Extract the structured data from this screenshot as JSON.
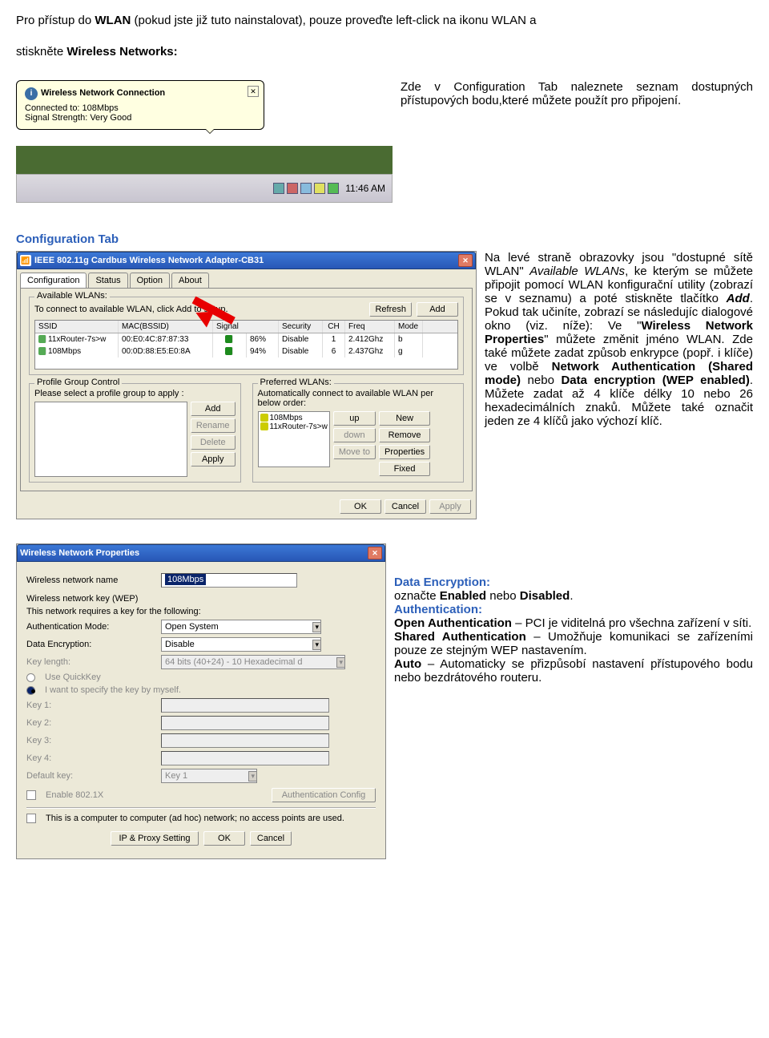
{
  "intro": {
    "p1a": "Pro přístup do ",
    "wlan": "WLAN",
    "p1b": " (pokud jste již tuto nainstalovat), pouze proveďte left-click na ikonu WLAN  a",
    "p2a": "stiskněte ",
    "wn": "Wireless Networks:",
    "p3": "Zde v Configuration Tab naleznete seznam dostupných přístupových bodu,které můžete použít pro připojení."
  },
  "balloon": {
    "title": "Wireless Network Connection",
    "l1": "Connected to: 108Mbps",
    "l2": "Signal Strength: Very Good",
    "time": "11:46 AM"
  },
  "section2": {
    "heading": "Configuration Tab",
    "para_spans": [
      {
        "t": "Na levé straně obrazovky jsou \"dostupné sítě WLAN\" ",
        "c": ""
      },
      {
        "t": "Available WLANs",
        "c": "italic"
      },
      {
        "t": ", ke kterým se můžete připojit pomocí WLAN konfigurační utility (zobrazí se v seznamu) a poté stiskněte tlačítko ",
        "c": ""
      },
      {
        "t": "Add",
        "c": "bold italic"
      },
      {
        "t": ". Pokud tak učiníte, zobrazí se následujíc dialogové okno (viz. níže): Ve \"",
        "c": ""
      },
      {
        "t": "Wireless Network Properties",
        "c": "bold"
      },
      {
        "t": "\" můžete změnit jméno WLAN. Zde také můžete zadat způsob enkrypce (popř. i klíče)  ve volbě ",
        "c": ""
      },
      {
        "t": "Network Authentication (Shared mode)",
        "c": "bold"
      },
      {
        "t": " nebo  ",
        "c": ""
      },
      {
        "t": "Data encryption (WEP enabled)",
        "c": "bold"
      },
      {
        "t": ". Můžete zadat až 4 klíče délky 10 nebo 26 hexadecimálních znaků. Můžete také označit jeden ze 4 klíčů jako výchozí klíč.",
        "c": ""
      }
    ],
    "util": {
      "title": "IEEE 802.11g Cardbus Wireless Network Adapter-CB31",
      "tabs": [
        "Configuration",
        "Status",
        "Option",
        "About"
      ],
      "avail_label": "Available WLANs:",
      "avail_hint": "To connect to available WLAN, click Add to setup.",
      "btn_refresh": "Refresh",
      "btn_add": "Add",
      "cols": [
        "SSID",
        "MAC(BSSID)",
        "Signal",
        "Security",
        "CH",
        "Freq",
        "Mode"
      ],
      "rows": [
        {
          "ssid": "11xRouter-7s>w",
          "mac": "00:E0:4C:87:87:33",
          "sig": "86%",
          "sec": "Disable",
          "ch": "1",
          "freq": "2.412Ghz",
          "mode": "b"
        },
        {
          "ssid": "108Mbps",
          "mac": "00:0D:88:E5:E0:8A",
          "sig": "94%",
          "sec": "Disable",
          "ch": "6",
          "freq": "2.437Ghz",
          "mode": "g"
        }
      ],
      "pgc": "Profile Group Control",
      "pgc_hint": "Please select a profile group to apply :",
      "pwl": "Preferred WLANs:",
      "pwl_hint": "Automatically connect to available WLAN per below order:",
      "pref": [
        "108Mbps",
        "11xRouter-7s>w"
      ],
      "btns_left": [
        "Add",
        "Rename",
        "Delete",
        "Apply"
      ],
      "btns_right": [
        "New",
        "Remove",
        "Properties",
        "Fixed"
      ],
      "btns_mid": [
        "up",
        "down",
        "Move to"
      ],
      "ok": "OK",
      "cancel": "Cancel",
      "apply": "Apply"
    }
  },
  "section3": {
    "para_spans": [
      {
        "t": "Data Encryption:",
        "c": "bold link"
      },
      {
        "t": "\n                       označte ",
        "c": ""
      },
      {
        "t": "Enabled",
        "c": "bold"
      },
      {
        "t": " nebo ",
        "c": ""
      },
      {
        "t": "Disabled",
        "c": "bold"
      },
      {
        "t": ".\n",
        "c": ""
      },
      {
        "t": "Authentication:",
        "c": "bold link"
      },
      {
        "t": "\n",
        "c": ""
      },
      {
        "t": "Open Authentication",
        "c": "bold"
      },
      {
        "t": " – PCI je viditelná pro všechna zařízení v síti.\n",
        "c": ""
      },
      {
        "t": "Shared Authentication",
        "c": "bold"
      },
      {
        "t": " – Umožňuje komunikaci se zařízeními pouze ze stejným  WEP nastavením.\n",
        "c": ""
      },
      {
        "t": "Auto",
        "c": "bold"
      },
      {
        "t": " – Automaticky se přizpůsobí nastavení přístupového bodu nebo bezdrátového routeru.",
        "c": ""
      }
    ],
    "props": {
      "title": "Wireless Network Properties",
      "name_label": "Wireless network name",
      "name_value": "108Mbps",
      "wep_label": "Wireless network key (WEP)",
      "wep_hint": "This network requires a key for the following:",
      "auth_label": "Authentication Mode:",
      "auth_value": "Open System",
      "enc_label": "Data Encryption:",
      "enc_value": "Disable",
      "keylen_label": "Key length:",
      "keylen_value": "64 bits (40+24) - 10 Hexadecimal d",
      "quick": "Use QuickKey",
      "manual": "I want to specify the key by myself.",
      "k1": "Key 1:",
      "k2": "Key 2:",
      "k3": "Key 3:",
      "k4": "Key 4:",
      "defkey": "Default key:",
      "defkey_value": "Key 1",
      "enable8021x": "Enable 802.1X",
      "authcfg": "Authentication Config",
      "adhoc": "This is a computer to computer (ad hoc) network; no access points are used.",
      "ipproxy": "IP & Proxy Setting",
      "ok": "OK",
      "cancel": "Cancel"
    }
  }
}
